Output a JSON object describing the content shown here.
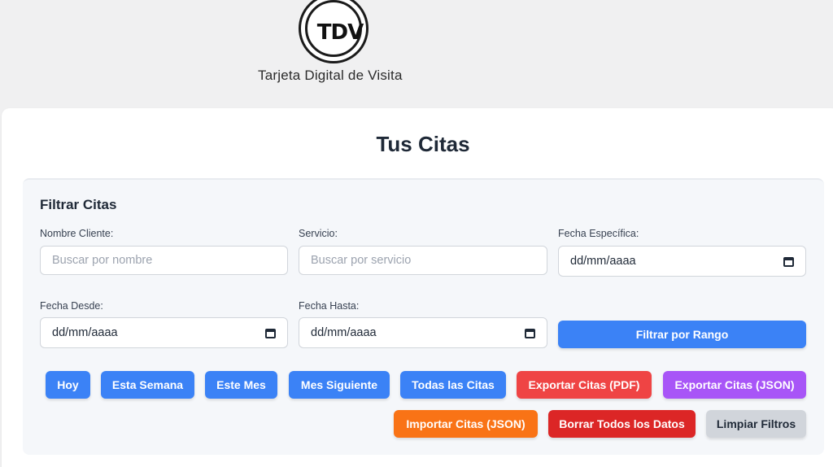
{
  "brand": {
    "logo_text": "TDV",
    "name": "Tarjeta Digital de Visita"
  },
  "page": {
    "title": "Tus Citas"
  },
  "filters": {
    "title": "Filtrar Citas",
    "client_name": {
      "label": "Nombre Cliente:",
      "placeholder": "Buscar por nombre",
      "value": ""
    },
    "service": {
      "label": "Servicio:",
      "placeholder": "Buscar por servicio",
      "value": ""
    },
    "specific_date": {
      "label": "Fecha Específica:",
      "value": "dd/mm/aaaa"
    },
    "date_from": {
      "label": "Fecha Desde:",
      "value": "dd/mm/aaaa"
    },
    "date_to": {
      "label": "Fecha Hasta:",
      "value": "dd/mm/aaaa"
    },
    "filter_range_label": "Filtrar por Rango"
  },
  "quick_buttons": {
    "today": "Hoy",
    "this_week": "Esta Semana",
    "this_month": "Este Mes",
    "next_month": "Mes Siguiente",
    "all": "Todas las Citas",
    "export_pdf": "Exportar Citas (PDF)",
    "export_json": "Exportar Citas (JSON)",
    "import_json": "Importar Citas (JSON)",
    "delete_all": "Borrar Todos los Datos",
    "clear_filters": "Limpiar Filtros"
  },
  "colors": {
    "primary": "#3b82f6",
    "danger": "#ef4444",
    "purple": "#a855f7",
    "orange": "#f97316",
    "dark_red": "#dc2626",
    "neutral": "#d1d5db"
  }
}
